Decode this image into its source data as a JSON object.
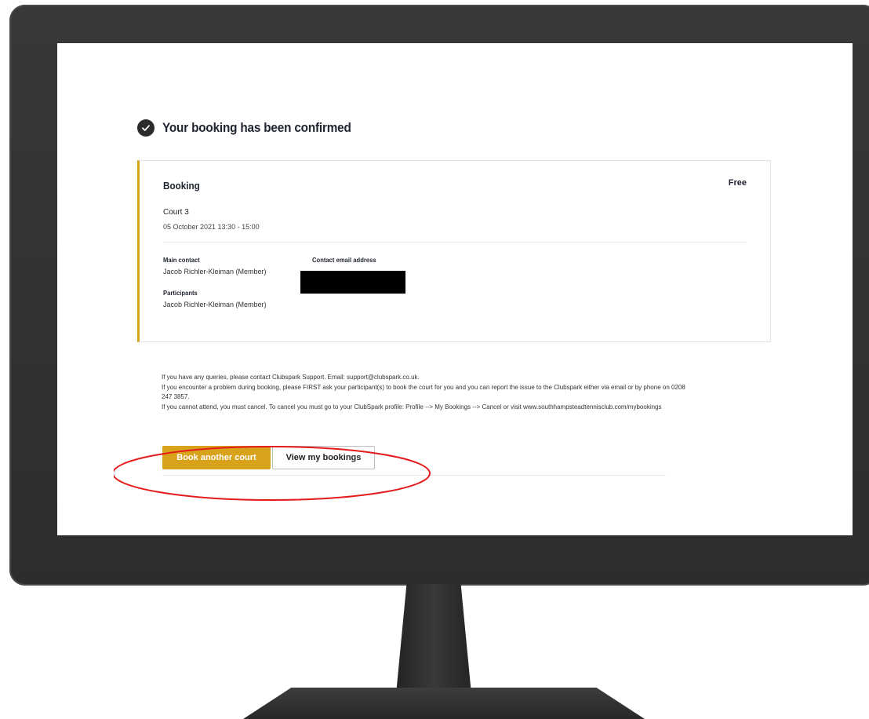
{
  "heading": {
    "text": "Your booking has been confirmed"
  },
  "booking": {
    "title": "Booking",
    "price": "Free",
    "court": "Court 3",
    "datetime": "05 October 2021 13:30 - 15:00",
    "main_contact_label": "Main contact",
    "main_contact_value": "Jacob Richler-Kleiman (Member)",
    "email_label": "Contact email address",
    "participants_label": "Participants",
    "participants_value": "Jacob Richler-Kleiman (Member)"
  },
  "info": {
    "line1": "If you have any queries, please contact Clubspark Support. Email: support@clubspark.co.uk.",
    "line2": "If you encounter a problem during booking, please FIRST ask your participant(s) to book the court for you and you can report the issue to the Clubspark either via email or by phone on 0208 247 3857.",
    "line3": "If you cannot attend, you must cancel. To cancel you must go to your ClubSpark profile: Profile --> My Bookings --> Cancel or visit www.southhampsteadtennisclub.com/mybookings"
  },
  "buttons": {
    "book_another": "Book another court",
    "view_bookings": "View my bookings"
  },
  "colors": {
    "accent": "#d9a21b",
    "annotation": "#e41b1b",
    "monitor": "#333130"
  },
  "icons": {
    "confirmed": "check-circle-icon"
  }
}
